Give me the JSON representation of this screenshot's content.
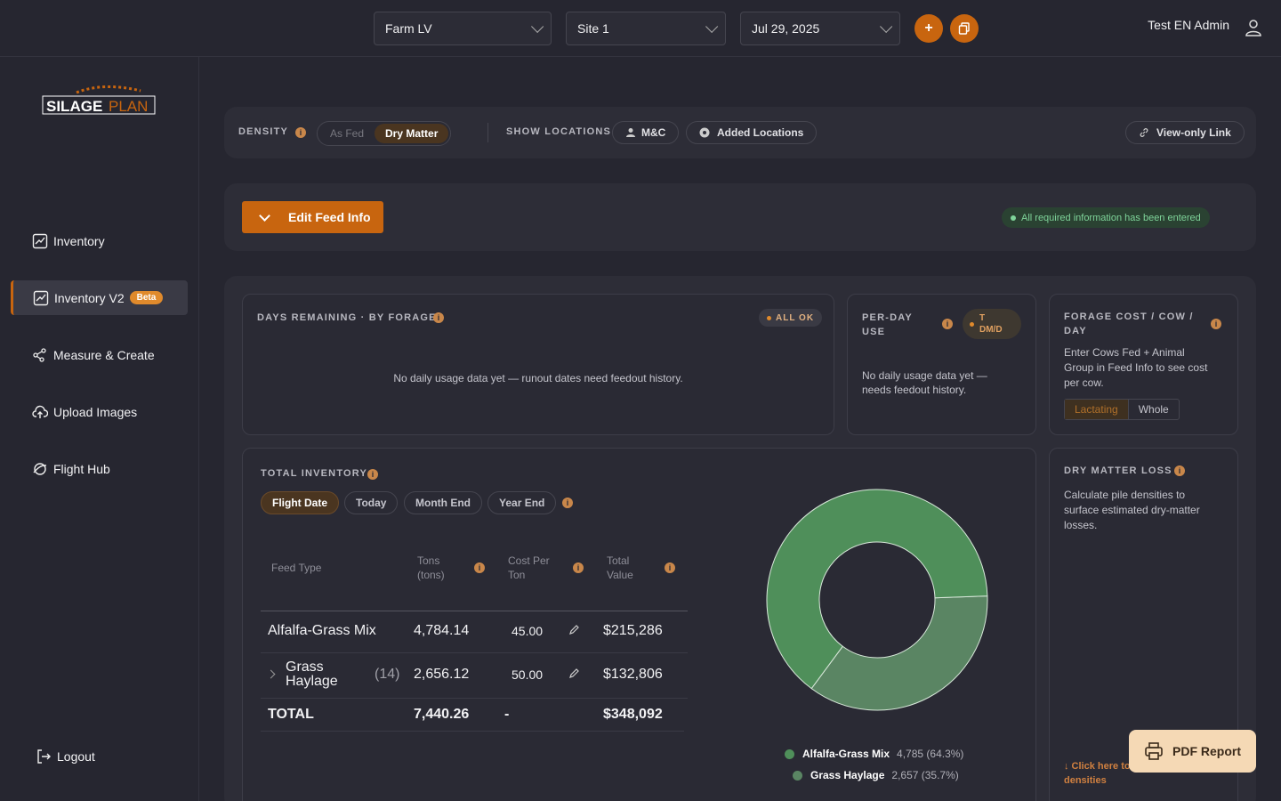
{
  "topbar": {
    "farm_select": "Farm LV",
    "site_select": "Site 1",
    "date_select": "Jul 29, 2025",
    "add_icon": "plus-icon",
    "copy_icon": "copy-icon",
    "user_name": "Test EN Admin"
  },
  "sidebar": {
    "logo_text_a": "SILAGE",
    "logo_text_b": "PLAN",
    "items": [
      {
        "label": "Inventory",
        "icon": "chart-icon"
      },
      {
        "label": "Inventory V2",
        "icon": "chart-icon",
        "badge": "Beta"
      },
      {
        "label": "Measure & Create",
        "icon": "measure-icon"
      },
      {
        "label": "Upload Images",
        "icon": "cloud-upload-icon"
      },
      {
        "label": "Flight Hub",
        "icon": "drone-icon"
      }
    ],
    "logout": "Logout"
  },
  "controls": {
    "density_label": "DENSITY",
    "as_fed": "As Fed",
    "dry_matter": "Dry Matter",
    "show_locations_label": "SHOW LOCATIONS",
    "mc": "M&C",
    "added_locations": "Added Locations",
    "view_only": "View-only Link"
  },
  "feed": {
    "edit_label": "Edit Feed Info",
    "status": "All required information has been entered"
  },
  "days_remaining": {
    "title": "DAYS REMAINING · BY FORAGE",
    "badge": "ALL OK",
    "empty": "No daily usage data yet — runout dates need feedout history."
  },
  "per_day": {
    "title_a": "PER-DAY",
    "title_b": "USE",
    "unit_a": "T",
    "unit_b": "DM/D",
    "empty_a": "No daily usage data yet —",
    "empty_b": "needs feedout history."
  },
  "forage_cost": {
    "title_a": "FORAGE COST / COW /",
    "title_b": "DAY",
    "desc_a": "Enter Cows Fed + Animal",
    "desc_b": "Group in Feed Info to see cost",
    "desc_c": "per cow.",
    "opt_a": "Lactating",
    "opt_b": "Whole"
  },
  "inventory": {
    "title": "TOTAL INVENTORY",
    "tabs": [
      "Flight Date",
      "Today",
      "Month End",
      "Year End"
    ],
    "headers": {
      "feed_type": "Feed Type",
      "tons_a": "Tons",
      "tons_b": "(tons)",
      "cost_a": "Cost Per",
      "cost_b": "Ton",
      "value_a": "Total",
      "value_b": "Value"
    },
    "rows": [
      {
        "name": "Alfalfa-Grass Mix",
        "tons": "4,784.14",
        "cost": "45.00",
        "value": "$215,286"
      },
      {
        "name_a": "Grass",
        "name_b": "Haylage",
        "count": "(14)",
        "tons": "2,656.12",
        "cost": "50.00",
        "value": "$132,806"
      }
    ],
    "total": {
      "label": "TOTAL",
      "tons": "7,440.26",
      "cost": "-",
      "value": "$348,092"
    }
  },
  "chart_data": {
    "type": "pie",
    "categories": [
      "Alfalfa-Grass Mix",
      "Grass Haylage"
    ],
    "values": [
      4785,
      2657
    ],
    "labels": [
      "4,785 (64.3%)",
      "2,657 (35.7%)"
    ],
    "colors": [
      "#4f8f5a",
      "#5a8563"
    ],
    "legend": "bottom"
  },
  "dry_matter": {
    "title": "DRY MATTER LOSS",
    "desc_a": "Calculate pile densities to",
    "desc_b": "surface estimated dry-matter",
    "desc_c": "losses.",
    "link_a": "↓ Click here to",
    "link_b": "densities"
  },
  "pdf": {
    "label": "PDF Report",
    "icon": "printer-icon"
  }
}
